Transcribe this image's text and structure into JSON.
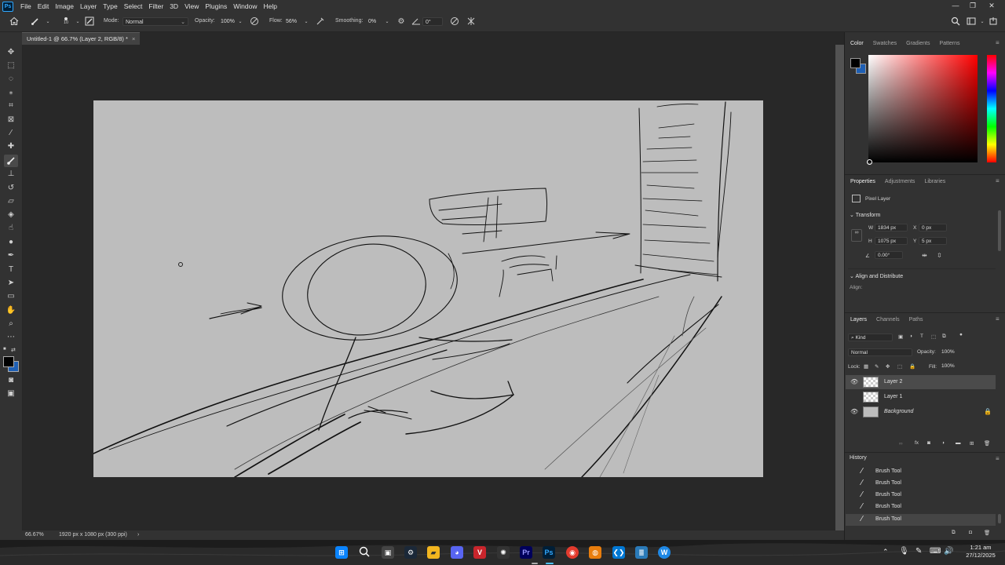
{
  "app": {
    "logo": "Ps"
  },
  "menu": [
    "File",
    "Edit",
    "Image",
    "Layer",
    "Type",
    "Select",
    "Filter",
    "3D",
    "View",
    "Plugins",
    "Window",
    "Help"
  ],
  "options": {
    "brush_size": "10",
    "mode_label": "Mode:",
    "mode_value": "Normal",
    "opacity_label": "Opacity:",
    "opacity_value": "100%",
    "flow_label": "Flow:",
    "flow_value": "56%",
    "smoothing_label": "Smoothing:",
    "smoothing_value": "0%",
    "angle_value": "0°"
  },
  "document": {
    "tab_title": "Untitled-1 @ 66.7% (Layer 2, RGB/8) *",
    "close": "×"
  },
  "status": {
    "zoom": "66.67%",
    "doc_info": "1920 px x 1080 px (300 ppi)",
    "arrow": "›"
  },
  "color_panel": {
    "tabs": [
      "Color",
      "Swatches",
      "Gradients",
      "Patterns"
    ],
    "foreground": "#000000",
    "background": "#1e5fb4",
    "hue_color": "#ff0000"
  },
  "properties_panel": {
    "tabs": [
      "Properties",
      "Adjustments",
      "Libraries"
    ],
    "layer_type": "Pixel Layer",
    "transform_title": "Transform",
    "w_label": "W",
    "w_value": "1834 px",
    "x_label": "X",
    "x_value": "0 px",
    "h_label": "H",
    "h_value": "1075 px",
    "y_label": "Y",
    "y_value": "5 px",
    "angle_value": "0.00°",
    "align_title": "Align and Distribute",
    "align_label": "Align:"
  },
  "layers_panel": {
    "tabs": [
      "Layers",
      "Channels",
      "Paths"
    ],
    "filter_kind": "Kind",
    "blend_mode": "Normal",
    "opacity_label": "Opacity:",
    "opacity_value": "100%",
    "lock_label": "Lock:",
    "fill_label": "Fill:",
    "fill_value": "100%",
    "layers": [
      {
        "name": "Layer 2",
        "visible": true,
        "selected": true
      },
      {
        "name": "Layer 1",
        "visible": false,
        "selected": false
      },
      {
        "name": "Background",
        "visible": true,
        "selected": false,
        "locked": true
      }
    ]
  },
  "history_panel": {
    "title": "History",
    "items": [
      "Brush Tool",
      "Brush Tool",
      "Brush Tool",
      "Brush Tool",
      "Brush Tool"
    ]
  },
  "taskbar": {
    "apps": [
      "windows-start",
      "search",
      "task-view",
      "steam",
      "file-explorer",
      "discord",
      "vivaldi",
      "chatgpt",
      "premiere-pro",
      "photoshop",
      "chrome",
      "blender",
      "vscode",
      "notepad",
      "wordpad"
    ],
    "time": "1:21 am",
    "date": "27/12/2025"
  }
}
